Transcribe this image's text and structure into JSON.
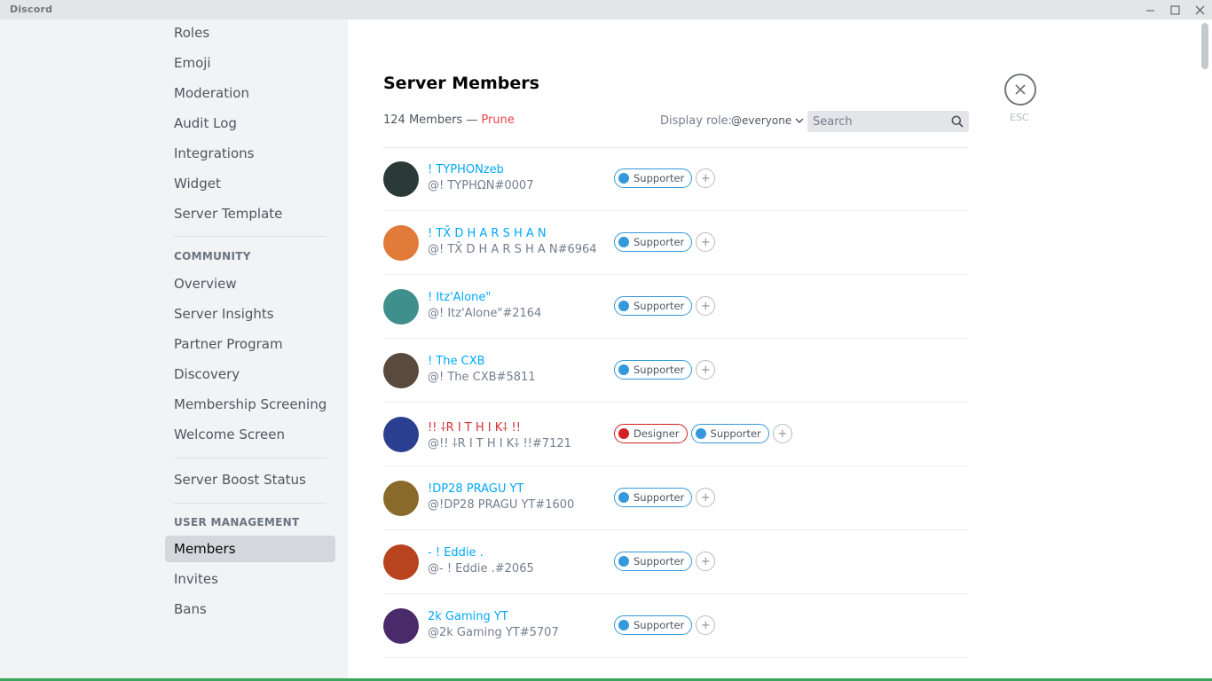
{
  "window": {
    "app_name": "Discord"
  },
  "sidebar": {
    "items_top": [
      {
        "label": "Roles"
      },
      {
        "label": "Emoji"
      },
      {
        "label": "Moderation"
      },
      {
        "label": "Audit Log"
      },
      {
        "label": "Integrations"
      },
      {
        "label": "Widget"
      },
      {
        "label": "Server Template"
      }
    ],
    "community_header": "COMMUNITY",
    "community_items": [
      {
        "label": "Overview"
      },
      {
        "label": "Server Insights"
      },
      {
        "label": "Partner Program"
      },
      {
        "label": "Discovery"
      },
      {
        "label": "Membership Screening"
      },
      {
        "label": "Welcome Screen"
      }
    ],
    "boost_label": "Server Boost Status",
    "user_mgmt_header": "USER MANAGEMENT",
    "user_mgmt_items": [
      {
        "label": "Members",
        "selected": true
      },
      {
        "label": "Invites"
      },
      {
        "label": "Bans"
      }
    ]
  },
  "main": {
    "title": "Server Members",
    "member_count": "124 Members —",
    "prune_label": "Prune",
    "display_role_label": "Display role:",
    "display_role_value": "@everyone",
    "search_placeholder": "Search",
    "esc_label": "ESC",
    "add_role_symbol": "+",
    "members": [
      {
        "name": "! TYPHONzeb",
        "tag": "@! TYPHΩN#0007",
        "avatar_color": "#2b3a36",
        "roles": [
          {
            "name": "Supporter",
            "color": "#3498db"
          }
        ]
      },
      {
        "name": "! TX̄̄̄ D H A R S H A N",
        "tag": "@! TX̄̄ D H A R S H A N#6964",
        "avatar_color": "#e07b39",
        "roles": [
          {
            "name": "Supporter",
            "color": "#3498db"
          }
        ]
      },
      {
        "name": "! Itz'Alone\"",
        "tag": "@! Itz'Alone\"#2164",
        "avatar_color": "#3f8f8c",
        "roles": [
          {
            "name": "Supporter",
            "color": "#3498db"
          }
        ]
      },
      {
        "name": "! The CXB",
        "tag": "@! The CXB#5811",
        "avatar_color": "#5a4a3e",
        "roles": [
          {
            "name": "Supporter",
            "color": "#3498db"
          }
        ]
      },
      {
        "name": "!! ⸸R I T H I K⸸ !!",
        "tag": "@!! ⸸R I T H I K⸸ !!#7121",
        "avatar_color": "#2a3f8f",
        "name_color": "#d43131",
        "roles": [
          {
            "name": "Designer",
            "color": "#d42020"
          },
          {
            "name": "Supporter",
            "color": "#3498db"
          }
        ]
      },
      {
        "name": "!DP28 PRAGU YT",
        "tag": "@!DP28 PRAGU YT#1600",
        "avatar_color": "#8a6a2a",
        "roles": [
          {
            "name": "Supporter",
            "color": "#3498db"
          }
        ]
      },
      {
        "name": "- ! Eddie .",
        "tag": "@- ! Eddie .#2065",
        "avatar_color": "#b8441f",
        "roles": [
          {
            "name": "Supporter",
            "color": "#3498db"
          }
        ]
      },
      {
        "name": "2k Gaming YT",
        "tag": "@2k Gaming YT#5707",
        "avatar_color": "#4a2a6a",
        "roles": [
          {
            "name": "Supporter",
            "color": "#3498db"
          }
        ]
      }
    ]
  },
  "colors": {
    "accent_blue": "#00a8fc",
    "danger_red": "#ed4245",
    "boost_pink": "#ff73fa",
    "bottom_bar": "#3aa55d"
  }
}
